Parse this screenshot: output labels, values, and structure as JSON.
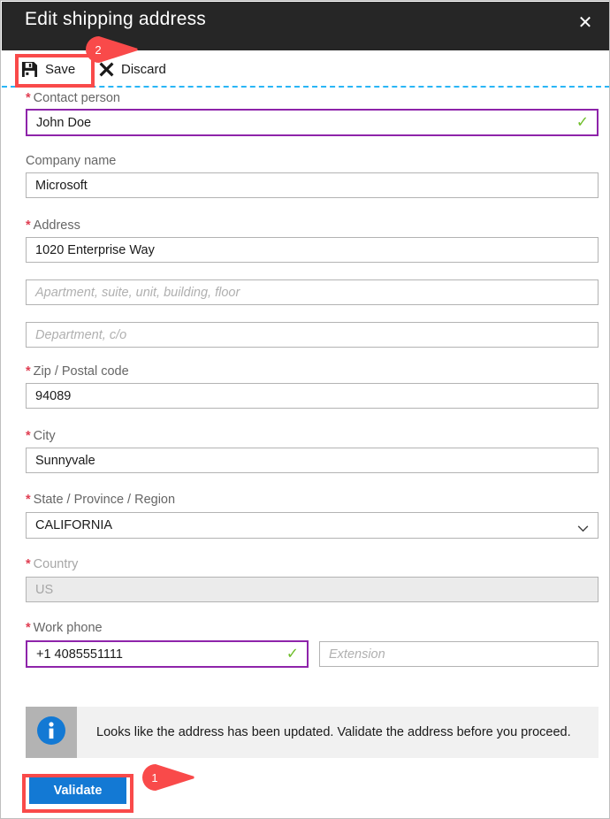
{
  "window": {
    "title": "Edit shipping address",
    "close_icon": "close-icon"
  },
  "toolbar": {
    "save_label": "Save",
    "save_icon": "save-floppy-icon",
    "discard_label": "Discard",
    "discard_icon": "x-cross-icon"
  },
  "form": {
    "fields": [
      {
        "key": "contact_person",
        "label": "Contact person",
        "required": true,
        "value": "John Doe",
        "placeholder": "",
        "state": "valid-focused",
        "validated": true
      },
      {
        "key": "company_name",
        "label": "Company name",
        "required": false,
        "value": "Microsoft",
        "placeholder": "",
        "state": "normal",
        "validated": false
      },
      {
        "key": "address",
        "label": "Address",
        "required": true,
        "value": "1020 Enterprise Way",
        "placeholder": "",
        "state": "normal",
        "validated": false
      },
      {
        "key": "address_line2",
        "label": "",
        "required": false,
        "value": "",
        "placeholder": "Apartment, suite, unit, building, floor",
        "state": "normal",
        "validated": false
      },
      {
        "key": "address_line3",
        "label": "",
        "required": false,
        "value": "",
        "placeholder": "Department, c/o",
        "state": "normal",
        "validated": false
      },
      {
        "key": "zip_postal_code",
        "label": "Zip / Postal code",
        "required": true,
        "value": "94089",
        "placeholder": "",
        "state": "normal",
        "validated": false
      },
      {
        "key": "city",
        "label": "City",
        "required": true,
        "value": "Sunnyvale",
        "placeholder": "",
        "state": "normal",
        "validated": false
      },
      {
        "key": "state_province_region",
        "label": "State / Province / Region",
        "required": true,
        "value": "CALIFORNIA",
        "placeholder": "",
        "state": "dropdown",
        "validated": false
      },
      {
        "key": "country",
        "label": "Country",
        "required": true,
        "value": "US",
        "placeholder": "",
        "state": "disabled",
        "validated": false
      },
      {
        "key": "work_phone",
        "label": "Work phone",
        "required": true,
        "value": "+1 4085551111",
        "placeholder": "",
        "state": "valid-focused",
        "validated": true
      },
      {
        "key": "extension",
        "label": "",
        "required": false,
        "value": "",
        "placeholder": "Extension",
        "state": "normal",
        "validated": false
      }
    ]
  },
  "info_bar": {
    "icon": "info-circle-icon",
    "message": "Looks like the address has been updated. Validate the address before you proceed."
  },
  "actions": {
    "validate_label": "Validate"
  },
  "annotations": {
    "callouts": [
      {
        "number": "1",
        "target": "validate-button"
      },
      {
        "number": "2",
        "target": "save-button"
      }
    ]
  },
  "colors": {
    "header_background": "#262626",
    "accent_blue": "#1379d4",
    "annotation_red": "#f94a4a",
    "required_asterisk": "#e03e52",
    "valid_check_green": "#6fbe2a",
    "focus_purple": "#8e24aa",
    "dashed_guide": "#29b6f6",
    "info_icon_blue": "#1379d4"
  }
}
